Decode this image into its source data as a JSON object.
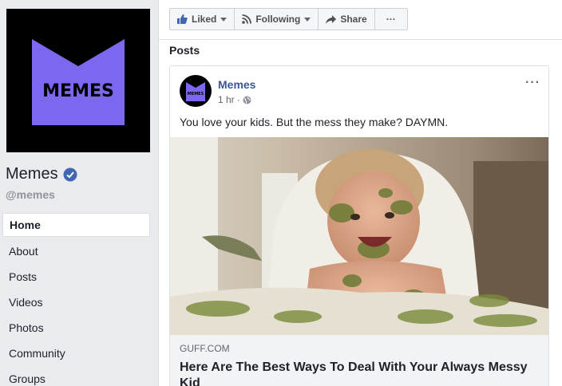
{
  "page": {
    "name": "Memes",
    "handle": "@memes",
    "logo_text": "MEMES"
  },
  "nav": {
    "items": [
      "Home",
      "About",
      "Posts",
      "Videos",
      "Photos",
      "Community",
      "Groups"
    ]
  },
  "actions": {
    "liked": "Liked",
    "following": "Following",
    "share": "Share",
    "more": "···"
  },
  "section": {
    "title": "Posts"
  },
  "post": {
    "author": "Memes",
    "time": "1 hr",
    "text": "You love your kids. But the mess they make? DAYMN.",
    "more": "···",
    "avatar_text": "MEMES",
    "link_domain": "GUFF.COM",
    "link_title": "Here Are The Best Ways To Deal With Your Always Messy Kid"
  },
  "colors": {
    "logo_purple": "#7b68ee",
    "link_blue": "#385898",
    "verified_blue": "#4267b2"
  }
}
